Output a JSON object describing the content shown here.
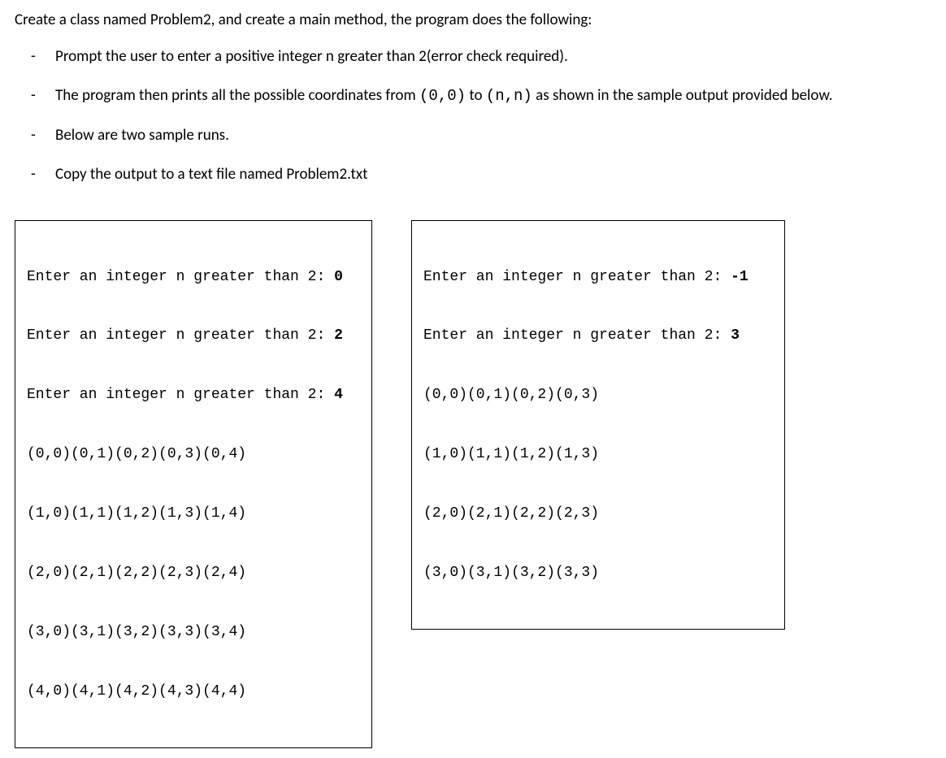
{
  "intro": "Create a class named Problem2, and create a main method, the program does the following:",
  "bullets": {
    "b0": "Prompt the user to enter a positive integer n greater than 2(error check required).",
    "b1_pre": "The program then prints all the possible coordinates from ",
    "b1_code1": "(0,0)",
    "b1_mid": " to ",
    "b1_code2": "(n,n)",
    "b1_post": " as shown in the sample output provided below.",
    "b2": "Below are two sample runs.",
    "b3": "Copy the output to a text file named Problem2.txt"
  },
  "sample1": {
    "lines": [
      {
        "prompt": "Enter an integer n greater than 2: ",
        "input": "0"
      },
      {
        "prompt": "Enter an integer n greater than 2: ",
        "input": "2"
      },
      {
        "prompt": "Enter an integer n greater than 2: ",
        "input": "4"
      },
      {
        "prompt": "(0,0)(0,1)(0,2)(0,3)(0,4)",
        "input": ""
      },
      {
        "prompt": "(1,0)(1,1)(1,2)(1,3)(1,4)",
        "input": ""
      },
      {
        "prompt": "(2,0)(2,1)(2,2)(2,3)(2,4)",
        "input": ""
      },
      {
        "prompt": "(3,0)(3,1)(3,2)(3,3)(3,4)",
        "input": ""
      },
      {
        "prompt": "(4,0)(4,1)(4,2)(4,3)(4,4)",
        "input": ""
      }
    ]
  },
  "sample2": {
    "lines": [
      {
        "prompt": "Enter an integer n greater than 2: ",
        "input": "-1"
      },
      {
        "prompt": "Enter an integer n greater than 2: ",
        "input": "3"
      },
      {
        "prompt": "(0,0)(0,1)(0,2)(0,3)",
        "input": ""
      },
      {
        "prompt": "(1,0)(1,1)(1,2)(1,3)",
        "input": ""
      },
      {
        "prompt": "(2,0)(2,1)(2,2)(2,3)",
        "input": ""
      },
      {
        "prompt": "(3,0)(3,1)(3,2)(3,3)",
        "input": ""
      }
    ]
  }
}
